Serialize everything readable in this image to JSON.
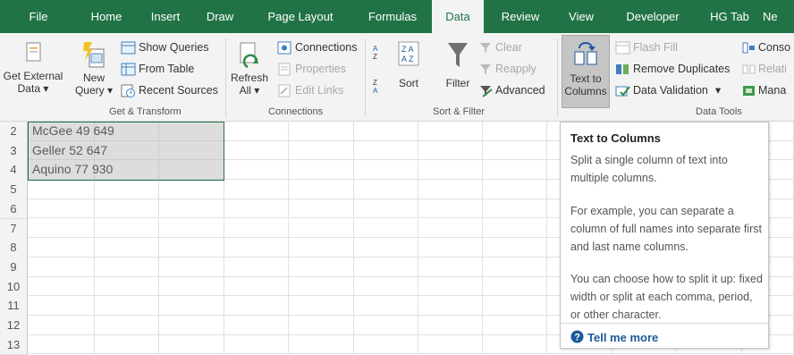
{
  "tabs": [
    {
      "label": "File",
      "active": false
    },
    {
      "label": "Home",
      "active": false
    },
    {
      "label": "Insert",
      "active": false
    },
    {
      "label": "Draw",
      "active": false
    },
    {
      "label": "Page Layout",
      "active": false
    },
    {
      "label": "Formulas",
      "active": false
    },
    {
      "label": "Data",
      "active": true
    },
    {
      "label": "Review",
      "active": false
    },
    {
      "label": "View",
      "active": false
    },
    {
      "label": "Developer",
      "active": false
    },
    {
      "label": "HG Tab",
      "active": false
    },
    {
      "label": "Ne",
      "active": false
    }
  ],
  "ribbon": {
    "get_transform": {
      "get_external_line1": "Get External",
      "get_external_line2": "Data ▾",
      "new_query_line1": "New",
      "new_query_line2": "Query ▾",
      "show_queries": "Show Queries",
      "from_table": "From Table",
      "recent_sources": "Recent Sources",
      "label": "Get & Transform"
    },
    "connections": {
      "refresh_line1": "Refresh",
      "refresh_line2": "All ▾",
      "connections": "Connections",
      "properties": "Properties",
      "edit_links": "Edit Links",
      "label": "Connections"
    },
    "sort_filter": {
      "sort": "Sort",
      "filter": "Filter",
      "clear": "Clear",
      "reapply": "Reapply",
      "advanced": "Advanced",
      "label": "Sort & Filter"
    },
    "data_tools": {
      "text_to_columns_line1": "Text to",
      "text_to_columns_line2": "Columns",
      "flash_fill": "Flash Fill",
      "remove_duplicates": "Remove Duplicates",
      "data_validation": "Data Validation",
      "consolidate": "Conso",
      "relationships": "Relati",
      "manage": "Mana",
      "label": "Data Tools"
    }
  },
  "rows": [
    {
      "num": "2",
      "text": "McGee 49 649"
    },
    {
      "num": "3",
      "text": "Geller 52 647"
    },
    {
      "num": "4",
      "text": "Aquino 77 930"
    },
    {
      "num": "5",
      "text": ""
    },
    {
      "num": "6",
      "text": ""
    },
    {
      "num": "7",
      "text": ""
    },
    {
      "num": "8",
      "text": ""
    },
    {
      "num": "9",
      "text": ""
    },
    {
      "num": "10",
      "text": ""
    },
    {
      "num": "11",
      "text": ""
    },
    {
      "num": "12",
      "text": ""
    },
    {
      "num": "13",
      "text": ""
    }
  ],
  "tooltip": {
    "title": "Text to Columns",
    "p1": "Split a single column of text into multiple columns.",
    "p2": "For example, you can separate a column of full names into separate first and last name columns.",
    "p3": "You can choose how to split it up: fixed width or split at each comma, period, or other character.",
    "link": "Tell me more"
  },
  "colors": {
    "excel_green": "#217346",
    "selection": "#217346",
    "link": "#1e5a9c"
  },
  "icons": [
    "document-icon",
    "query-icon",
    "table-icon",
    "clock-icon",
    "refresh-icon",
    "connections-icon",
    "properties-icon",
    "edit-links-icon",
    "sort-az-icon",
    "sort-icon",
    "filter-icon",
    "clear-filter-icon",
    "reapply-icon",
    "advanced-filter-icon",
    "text-to-columns-icon",
    "flash-fill-icon",
    "remove-duplicates-icon",
    "data-validation-icon",
    "consolidate-icon",
    "relationships-icon",
    "manage-icon",
    "help-icon"
  ]
}
